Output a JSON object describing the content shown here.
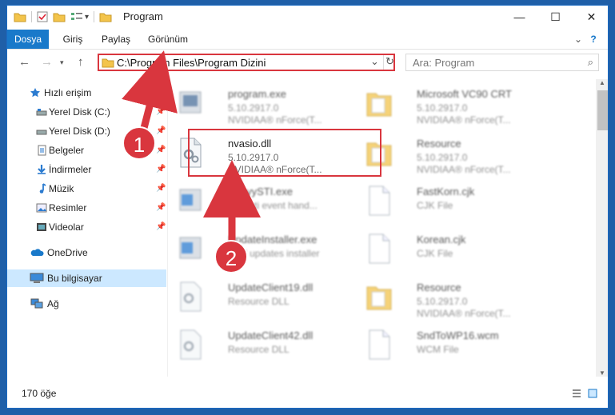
{
  "window": {
    "title": "Program",
    "controls": {
      "minimize": "—",
      "maximize": "☐",
      "close": "✕"
    }
  },
  "ribbon": {
    "tabs": [
      "Dosya",
      "Giriş",
      "Paylaş",
      "Görünüm"
    ],
    "expand": "⌄",
    "help": "?"
  },
  "address": {
    "path": "C:\\Program Files\\Program Dizini",
    "dropdown": "⌄",
    "refresh": "↻"
  },
  "search": {
    "placeholder": "Ara: Program"
  },
  "nav": {
    "items": [
      {
        "label": "Hızlı erişim"
      },
      {
        "label": "Yerel Disk (C:)"
      },
      {
        "label": "Yerel Disk (D:)"
      },
      {
        "label": "Belgeler"
      },
      {
        "label": "İndirmeler"
      },
      {
        "label": "Müzik"
      },
      {
        "label": "Resimler"
      },
      {
        "label": "Videolar"
      },
      {
        "label": "OneDrive"
      },
      {
        "label": "Bu bilgisayar"
      },
      {
        "label": "Ağ"
      }
    ],
    "pin": "📌"
  },
  "files": {
    "left": [
      {
        "name": "program.exe",
        "l2": "5.10.2917.0",
        "l3": "NVIDIAA® nForce(T..."
      },
      {
        "name": "nvasio.dll",
        "l2": "5.10.2917.0",
        "l3": "NVIDIAA® nForce(T..."
      },
      {
        "name": "AbbyySTI.exe",
        "l2": "BBY sti event hand..."
      },
      {
        "name": "UpdateInstaller.exe",
        "l2": "BBY updates installer"
      },
      {
        "name": "UpdateClient19.dll",
        "l2": "Resource DLL"
      },
      {
        "name": "UpdateClient42.dll",
        "l2": "Resource DLL"
      }
    ],
    "right": [
      {
        "name": "Microsoft VC90 CRT",
        "l2": "5.10.2917.0",
        "l3": "NVIDIAA® nForce(T..."
      },
      {
        "name": "Resource",
        "l2": "5.10.2917.0",
        "l3": "NVIDIAA® nForce(T..."
      },
      {
        "name": "FastKorn.cjk",
        "l2": "CJK File"
      },
      {
        "name": "Korean.cjk",
        "l2": "CJK File"
      },
      {
        "name": "Resource",
        "l2": "5.10.2917.0",
        "l3": "NVIDIAA® nForce(T..."
      },
      {
        "name": "SndToWP16.wcm",
        "l2": "WCM File"
      }
    ]
  },
  "status": {
    "count": "170 öğe"
  },
  "annotations": {
    "badge1": "1",
    "badge2": "2"
  },
  "colors": {
    "accent": "#1979ca",
    "highlight": "#d9363e",
    "selection": "#cce8ff"
  }
}
